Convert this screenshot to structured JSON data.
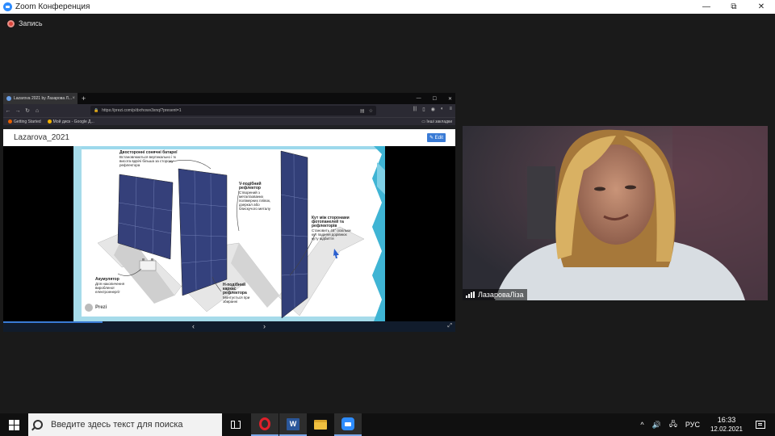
{
  "zoom": {
    "window_title": "Zoom Конференция",
    "recording_label": "Запись",
    "minimize": "—",
    "maximize": "⧉",
    "close": "✕"
  },
  "browser": {
    "tab_title": "Lazarova 2021 by Лазарова Л...",
    "tab_close": "×",
    "new_tab": "+",
    "url": "https://prezi.com/p/dxrhowv3xnq/?present=1",
    "bookmarks": [
      "Getting Started",
      "Мой диск - Google Д..."
    ],
    "all_bookmarks": "Інші закладки",
    "minimize": "—",
    "maximize": "☐",
    "close": "✕"
  },
  "prezi": {
    "title": "Lazarova_2021",
    "edit_label": "✎ Edit",
    "logo": "Prezi",
    "prev": "‹",
    "next": "›",
    "fullscreen": "⤢",
    "progress": 0.22
  },
  "slide": {
    "texts": [
      {
        "title": "Двосторонні сонячні батареї",
        "body": "Встановлюються вертикально і їх висота вдвічі більша за сторону рефлектора"
      },
      {
        "title": "V-подібний рефлектор",
        "body": "Створений з металізованих полімерних плівок, дзеркал або блискучого металу"
      },
      {
        "title": "Кут між сторонами фотопанелей та рефлекторів",
        "body": "Становить 45° оскільки кут падіння дорівнює куту відбиття"
      },
      {
        "title": "Акумулятор",
        "body": "Для накопичення виробленої електроенергії"
      },
      {
        "title": "Н-подібний каркас рефлектора",
        "body": "Монтується при збиранні"
      }
    ]
  },
  "video": {
    "participant_name": "ЛазароваЛіза"
  },
  "taskbar": {
    "search_placeholder": "Введите здесь текст для поиска",
    "word_letter": "W",
    "chevron": "^",
    "volume": "🔊",
    "network": "🖧",
    "language": "РУС",
    "time": "16:33",
    "date": "12.02.2021"
  }
}
